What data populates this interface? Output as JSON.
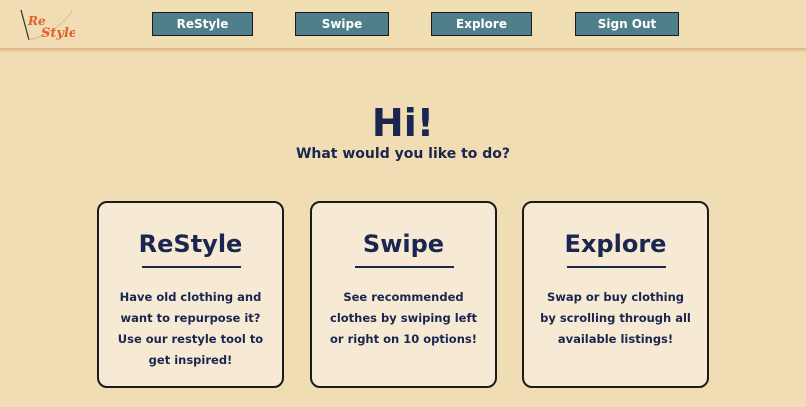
{
  "app": {
    "logo_text_top": "Re",
    "logo_text_bottom": "Style",
    "brand_color": "#e0602e"
  },
  "nav": {
    "items": [
      {
        "label": "ReStyle"
      },
      {
        "label": "Swipe"
      },
      {
        "label": "Explore"
      },
      {
        "label": "Sign Out"
      }
    ],
    "button_color": "#4f7f8a"
  },
  "hero": {
    "title": "Hi!",
    "subtitle": "What would you like to do?"
  },
  "cards": [
    {
      "title": "ReStyle",
      "description": "Have old clothing and want to repurpose it? Use our restyle tool to get inspired!"
    },
    {
      "title": "Swipe",
      "description": "See recommended clothes by swiping left or right on 10 options!"
    },
    {
      "title": "Explore",
      "description": "Swap or buy clothing by scrolling through all available listings!"
    }
  ],
  "colors": {
    "background": "#f0ddb3",
    "card_background": "#f6ead4",
    "text": "#1a2550"
  }
}
